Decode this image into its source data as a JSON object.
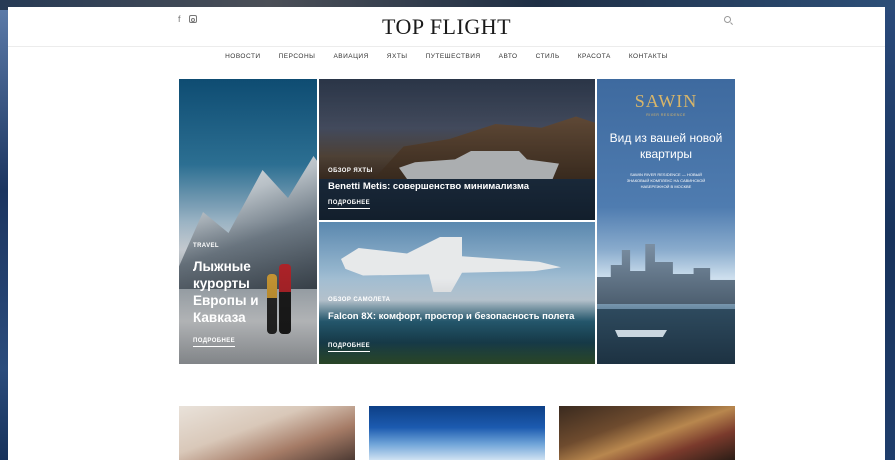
{
  "header": {
    "logo": "TOP FLIGHT",
    "social": [
      "f"
    ]
  },
  "nav": [
    "НОВОСТИ",
    "ПЕРСОНЫ",
    "АВИАЦИЯ",
    "ЯХТЫ",
    "ПУТЕШЕСТВИЯ",
    "АВТО",
    "СТИЛЬ",
    "КРАСОТА",
    "КОНТАКТЫ"
  ],
  "hero": {
    "travel": {
      "label": "TRAVEL",
      "title": "Лыжные курорты Европы и Кавказа",
      "more": "ПОДРОБНЕЕ"
    },
    "yacht": {
      "label": "ОБЗОР ЯХТЫ",
      "title": "Benetti Metis: совершенство минимализма",
      "more": "ПОДРОБНЕЕ"
    },
    "jet": {
      "label": "ОБЗОР САМОЛЕТА",
      "title": "Falcon 8X: комфорт, простор и безопасность полета",
      "more": "ПОДРОБНЕЕ"
    },
    "ad": {
      "brand": "SAWIN",
      "sub": "RIVER RESIDENCE",
      "heading": "Вид из вашей новой квартиры",
      "small": "SAWIN RIVER RESIDENCE — НОВЫЙ ЗНАКОВЫЙ КОМПЛЕКС НА САВИНСКОЙ НАБЕРЕЖНОЙ В МОСКВЕ"
    }
  },
  "colors": {
    "ad_gold": "#d7b56a",
    "ad_bg": "#4f7cb0"
  }
}
